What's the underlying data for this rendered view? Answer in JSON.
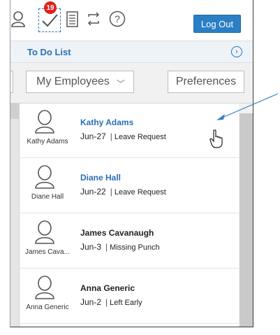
{
  "toolbar": {
    "icons": [
      "user-icon",
      "checkmark-icon",
      "document-list-icon",
      "refresh-icon",
      "help-icon"
    ],
    "todo_badge_count": "19",
    "logout_label": "Log Out",
    "accent_color": "#2b7fc4",
    "badge_color": "#e0201a"
  },
  "todo_bar": {
    "title": "To Do List",
    "nav_icon": "chevron-right-circle-icon"
  },
  "filters": {
    "employees_select_value": "My Employees",
    "preferences_label": "Preferences"
  },
  "todo_items": [
    {
      "avatar_label": "Kathy Adams",
      "name": "Kathy Adams",
      "date": "Jun-27",
      "request": "Leave Request",
      "name_style": "link"
    },
    {
      "avatar_label": "Diane Hall",
      "name": "Diane Hall",
      "date": "Jun-22",
      "request": "Leave Request",
      "name_style": "link"
    },
    {
      "avatar_label": "James Cava...",
      "name": "James Cavanaugh",
      "date": "Jun-3",
      "request": "Missing Punch",
      "name_style": "plain"
    },
    {
      "avatar_label": "Anna Generic",
      "name": "Anna Generic",
      "date": "Jun-2",
      "request": "Left Early",
      "name_style": "plain"
    }
  ]
}
